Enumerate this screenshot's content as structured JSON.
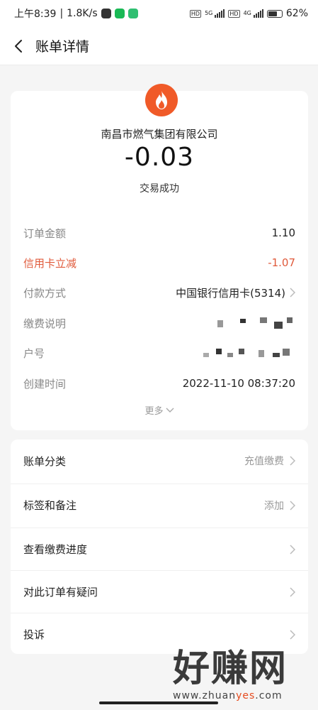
{
  "status_bar": {
    "time": "上午8:39",
    "speed": "1.8K/s",
    "net1": "5G",
    "net2": "4G",
    "battery": "62%"
  },
  "header": {
    "title": "账单详情"
  },
  "merchant": {
    "name": "南昌市燃气集团有限公司",
    "amount": "-0.03",
    "status": "交易成功",
    "logo_color": "#f05a28"
  },
  "details": [
    {
      "label": "订单金额",
      "value": "1.10"
    },
    {
      "label": "信用卡立减",
      "value": "-1.07"
    },
    {
      "label": "付款方式",
      "value": "中国银行信用卡(5314)"
    },
    {
      "label": "缴费说明",
      "value": ""
    },
    {
      "label": "户号",
      "value": ""
    },
    {
      "label": "创建时间",
      "value": "2022-11-10 08:37:20"
    }
  ],
  "more_label": "更多",
  "menu": [
    {
      "label": "账单分类",
      "value": "充值缴费"
    },
    {
      "label": "标签和备注",
      "value": "添加"
    },
    {
      "label": "查看缴费进度",
      "value": ""
    },
    {
      "label": "对此订单有疑问",
      "value": ""
    },
    {
      "label": "投诉",
      "value": ""
    }
  ],
  "watermark": {
    "big": "好赚网",
    "url_prefix": "www.zhuan",
    "url_accent": "yes",
    "url_suffix": ".com"
  },
  "colors": {
    "accent_red": "#e05a3b",
    "muted": "#888888"
  }
}
